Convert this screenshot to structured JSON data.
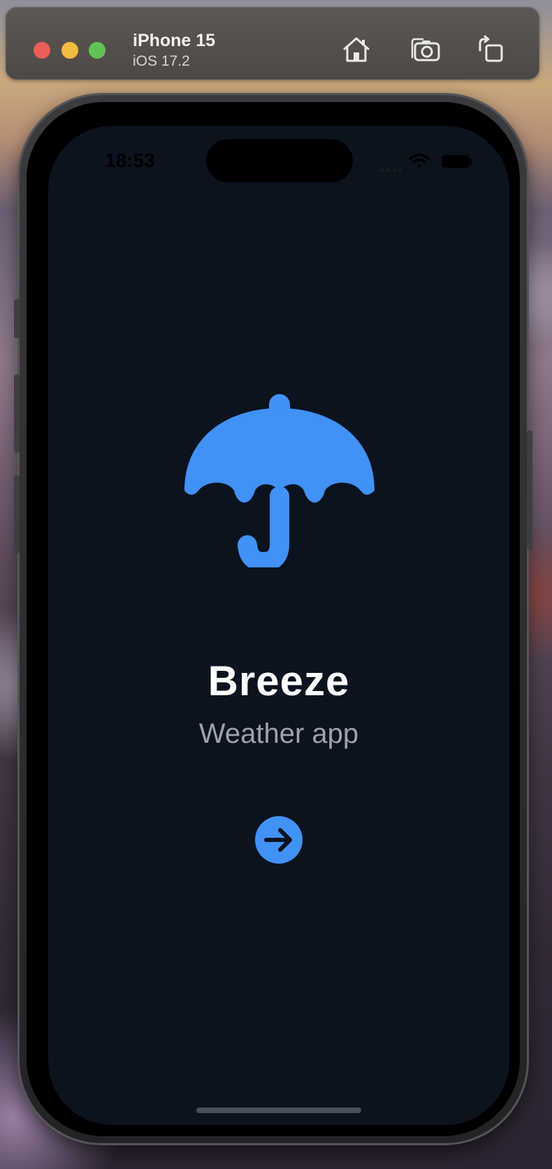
{
  "simulator": {
    "device_name": "iPhone 15",
    "os_version": "iOS 17.2",
    "toolbar_icons": [
      "home-icon",
      "screenshot-icon",
      "rotate-icon"
    ]
  },
  "status_bar": {
    "time": "18:53",
    "icons": [
      "signal-icon",
      "wifi-icon",
      "battery-icon"
    ]
  },
  "app": {
    "logo_icon": "umbrella-icon",
    "title": "Breeze",
    "subtitle": "Weather app",
    "next_button_icon": "arrow-right-icon"
  },
  "colors": {
    "screen_background": "#0b131f",
    "accent": "#4291f5",
    "title_text": "#ffffff",
    "subtitle_text": "#9da3ad"
  }
}
